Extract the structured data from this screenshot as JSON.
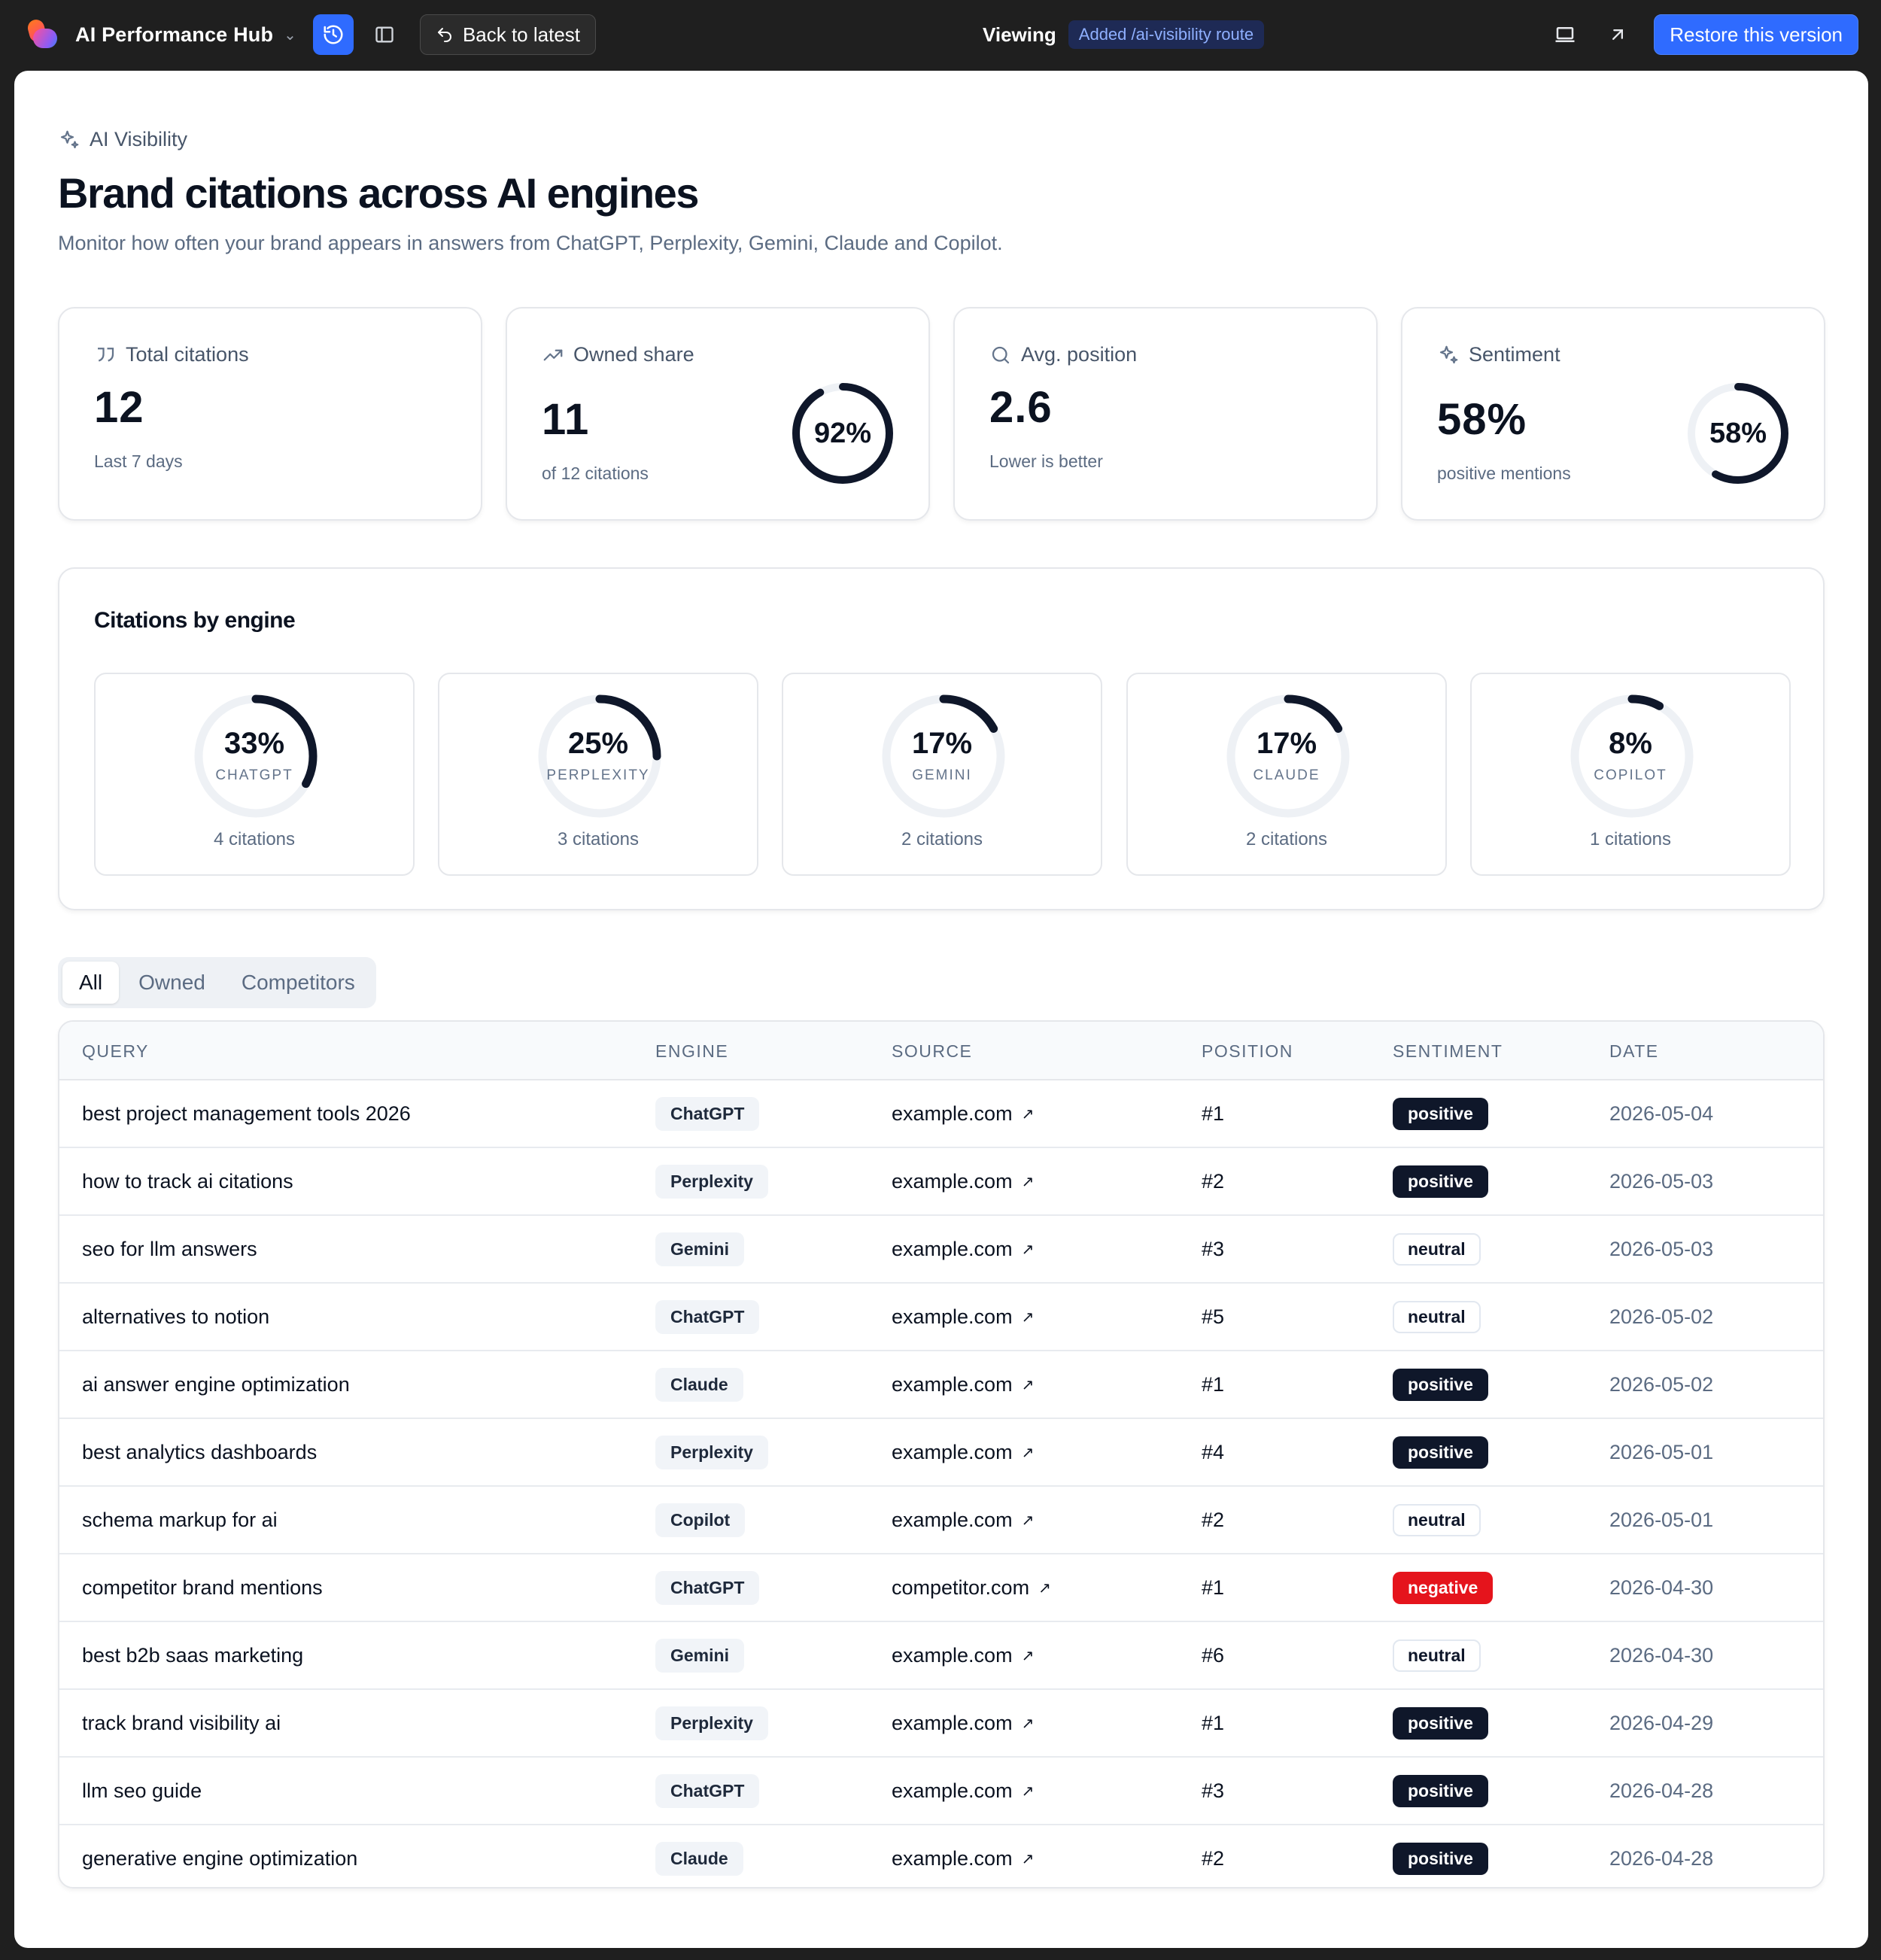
{
  "topbar": {
    "app_name": "AI Performance Hub",
    "back_label": "Back to latest",
    "viewing_label": "Viewing",
    "version_label": "Added /ai-visibility route",
    "restore_label": "Restore this version"
  },
  "header": {
    "eyebrow": "AI Visibility",
    "title": "Brand citations across AI engines",
    "subtitle": "Monitor how often your brand appears in answers from ChatGPT, Perplexity, Gemini, Claude and Copilot."
  },
  "stats": [
    {
      "label": "Total citations",
      "value": "12",
      "note": "Last 7 days",
      "icon": "quote-icon"
    },
    {
      "label": "Owned share",
      "value": "11",
      "note": "of 12 citations",
      "icon": "trending-up-icon",
      "ring_label": "92%",
      "ring_fraction": 0.92
    },
    {
      "label": "Avg. position",
      "value": "2.6",
      "note": "Lower is better",
      "icon": "search-icon"
    },
    {
      "label": "Sentiment",
      "value": "58%",
      "note": "positive mentions",
      "icon": "sparkles-icon",
      "ring_label": "58%",
      "ring_fraction": 0.58
    }
  ],
  "engines": {
    "title": "Citations by engine",
    "items": [
      {
        "pct": "33%",
        "fraction": 0.33,
        "name": "CHATGPT",
        "count": "4 citations"
      },
      {
        "pct": "25%",
        "fraction": 0.25,
        "name": "PERPLEXITY",
        "count": "3 citations"
      },
      {
        "pct": "17%",
        "fraction": 0.17,
        "name": "GEMINI",
        "count": "2 citations"
      },
      {
        "pct": "17%",
        "fraction": 0.17,
        "name": "CLAUDE",
        "count": "2 citations"
      },
      {
        "pct": "8%",
        "fraction": 0.08,
        "name": "COPILOT",
        "count": "1 citations"
      }
    ]
  },
  "tabs": [
    "All",
    "Owned",
    "Competitors"
  ],
  "table": {
    "columns": [
      "QUERY",
      "ENGINE",
      "SOURCE",
      "POSITION",
      "SENTIMENT",
      "DATE"
    ],
    "rows": [
      {
        "query": "best project management tools 2026",
        "engine": "ChatGPT",
        "source": "example.com",
        "position": "#1",
        "sentiment": "positive",
        "date": "2026-05-04"
      },
      {
        "query": "how to track ai citations",
        "engine": "Perplexity",
        "source": "example.com",
        "position": "#2",
        "sentiment": "positive",
        "date": "2026-05-03"
      },
      {
        "query": "seo for llm answers",
        "engine": "Gemini",
        "source": "example.com",
        "position": "#3",
        "sentiment": "neutral",
        "date": "2026-05-03"
      },
      {
        "query": "alternatives to notion",
        "engine": "ChatGPT",
        "source": "example.com",
        "position": "#5",
        "sentiment": "neutral",
        "date": "2026-05-02"
      },
      {
        "query": "ai answer engine optimization",
        "engine": "Claude",
        "source": "example.com",
        "position": "#1",
        "sentiment": "positive",
        "date": "2026-05-02"
      },
      {
        "query": "best analytics dashboards",
        "engine": "Perplexity",
        "source": "example.com",
        "position": "#4",
        "sentiment": "positive",
        "date": "2026-05-01"
      },
      {
        "query": "schema markup for ai",
        "engine": "Copilot",
        "source": "example.com",
        "position": "#2",
        "sentiment": "neutral",
        "date": "2026-05-01"
      },
      {
        "query": "competitor brand mentions",
        "engine": "ChatGPT",
        "source": "competitor.com",
        "position": "#1",
        "sentiment": "negative",
        "date": "2026-04-30"
      },
      {
        "query": "best b2b saas marketing",
        "engine": "Gemini",
        "source": "example.com",
        "position": "#6",
        "sentiment": "neutral",
        "date": "2026-04-30"
      },
      {
        "query": "track brand visibility ai",
        "engine": "Perplexity",
        "source": "example.com",
        "position": "#1",
        "sentiment": "positive",
        "date": "2026-04-29"
      },
      {
        "query": "llm seo guide",
        "engine": "ChatGPT",
        "source": "example.com",
        "position": "#3",
        "sentiment": "positive",
        "date": "2026-04-28"
      },
      {
        "query": "generative engine optimization",
        "engine": "Claude",
        "source": "example.com",
        "position": "#2",
        "sentiment": "positive",
        "date": "2026-04-28"
      }
    ]
  },
  "colors": {
    "accent": "#2f6bff",
    "ring": "#0f172a",
    "ring_track": "#eef1f5",
    "negative": "#e5141c"
  }
}
